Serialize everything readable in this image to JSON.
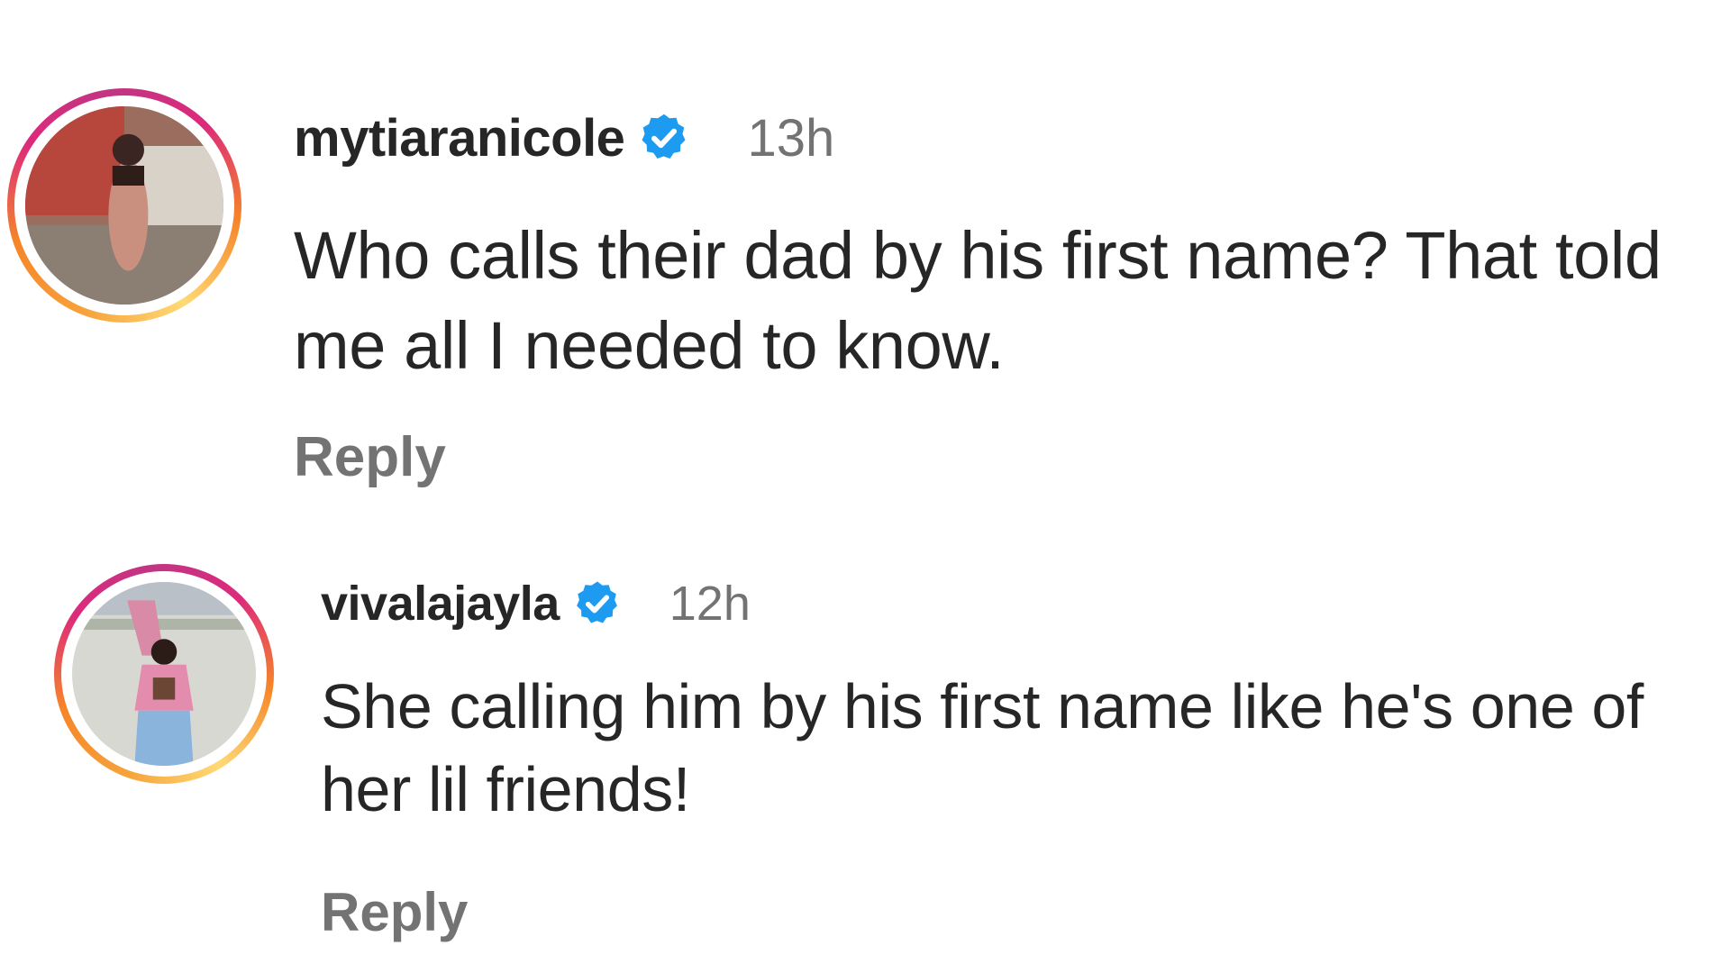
{
  "comments": [
    {
      "username": "mytiaranicole",
      "verified": true,
      "timestamp": "13h",
      "text": "Who calls their dad by his first name? That told me all I needed to know.",
      "reply_label": "Reply",
      "avatar_icon": "profile-photo-icon"
    },
    {
      "username": "vivalajayla",
      "verified": true,
      "timestamp": "12h",
      "text": "She calling him by his first name like he's one of her lil friends!",
      "reply_label": "Reply",
      "avatar_icon": "profile-photo-icon"
    }
  ],
  "colors": {
    "verified_badge": "#1d9bf0",
    "username": "#262626",
    "secondary_text": "#737373",
    "ring_gradient": [
      "#feda75",
      "#f58529",
      "#dd2a7b",
      "#c13584"
    ]
  }
}
